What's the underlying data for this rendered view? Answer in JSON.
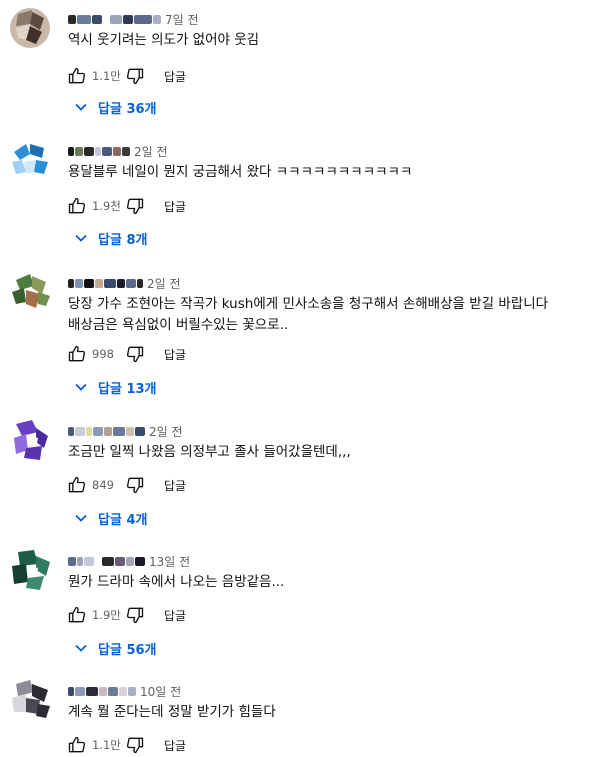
{
  "colors": {
    "link": "#065fd4",
    "secondary": "#606060",
    "text": "#0f0f0f"
  },
  "comments": [
    {
      "time": "7일 전",
      "lines": [
        "역시 웃기려는 의도가 없어야 웃김"
      ],
      "likes": "1.1만",
      "reply_label": "답글",
      "replies": "답글 36개",
      "avatar_colors": [
        "#8a7a6e",
        "#c9b8a8",
        "#5a4a40",
        "#e0d4c8",
        "#3f342d"
      ]
    },
    {
      "time": "2일 전",
      "lines": [
        "용달블루 네일이 뭔지 궁금해서 왔다 ㅋㅋㅋㅋㅋㅋㅋㅋㅋㅋㅋ"
      ],
      "likes": "1.9천",
      "reply_label": "답글",
      "replies": "답글 8개",
      "avatar_colors": [
        "#2a8fd6",
        "#9fd0f2",
        "#ffffff",
        "#1b6fb3",
        "#cfe8f8"
      ]
    },
    {
      "time": "2일 전",
      "lines": [
        "당장 가수 조현아는 작곡가 kush에게 민사소송을 청구해서 손해배상을 받길 바랍니다",
        "배상금은 욕심없이 버릴수있는 꽃으로.."
      ],
      "likes": "998",
      "reply_label": "답글",
      "replies": "답글 13개",
      "avatar_colors": [
        "#4f7d3c",
        "#8a9a5b",
        "#3b5e2b",
        "#a3704a",
        "#6f8f4e"
      ]
    },
    {
      "time": "2일 전",
      "lines": [
        "조금만 일찍 나왔음 의정부고 졸사 들어갔을텐데,,,"
      ],
      "likes": "849",
      "reply_label": "답글",
      "replies": "답글 4개",
      "avatar_colors": [
        "#6a3fc4",
        "#4b2a9c",
        "#8f6ae0",
        "#ffffff",
        "#5a34b0"
      ]
    },
    {
      "time": "13일 전",
      "lines": [
        "뭔가 드라마 속에서 나오는 음방같음..."
      ],
      "likes": "1.9만",
      "reply_label": "답글",
      "replies": "답글 56개",
      "avatar_colors": [
        "#1e5c4a",
        "#2f7a62",
        "#173f33",
        "#ffffff",
        "#3c8a70"
      ]
    },
    {
      "time": "10일 전",
      "lines": [
        "계속 뭘 준다는데 정말 받기가 힘들다"
      ],
      "likes": "1.1만",
      "reply_label": "답글",
      "replies": "",
      "avatar_colors": [
        "#2b2b33",
        "#8c8c96",
        "#d6d6dc",
        "#4a4a55",
        "#ffffff"
      ]
    }
  ]
}
